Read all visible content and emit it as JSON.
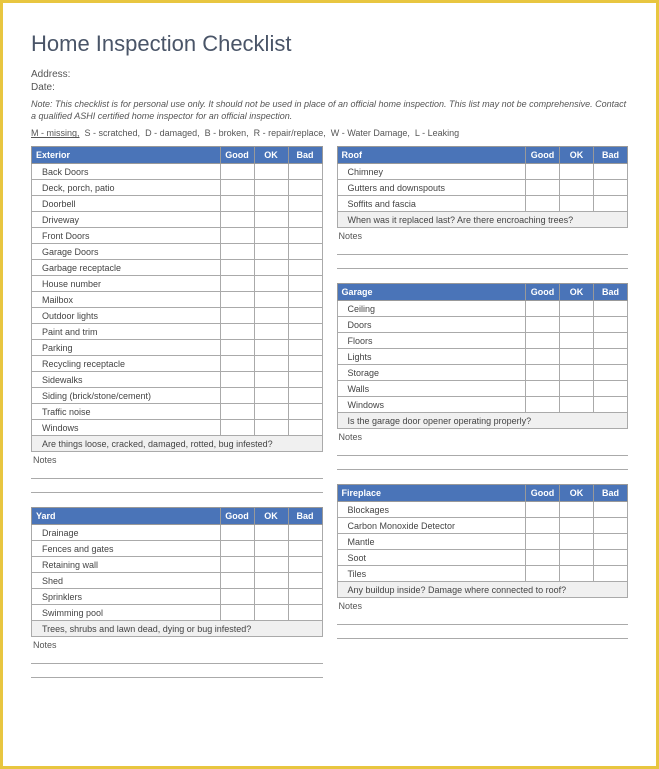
{
  "title": "Home Inspection Checklist",
  "address_label": "Address:",
  "date_label": "Date:",
  "note": "Note: This checklist is for personal use only. It should not be used in place of an official home inspection. This list may not be comprehensive. Contact a qualified ASHI certified home inspector for an official inspection.",
  "legend": {
    "m": "M - missing,",
    "s": "S - scratched,",
    "d": "D - damaged,",
    "b": "B - broken,",
    "r": "R - repair/replace,",
    "w": "W - Water Damage,",
    "l": "L - Leaking"
  },
  "cols": {
    "good": "Good",
    "ok": "OK",
    "bad": "Bad"
  },
  "notes_label": "Notes",
  "sections": {
    "exterior": {
      "title": "Exterior",
      "items": [
        "Back Doors",
        "Deck, porch, patio",
        "Doorbell",
        "Driveway",
        "Front Doors",
        "Garage Doors",
        "Garbage receptacle",
        "House number",
        "Mailbox",
        "Outdoor lights",
        "Paint and trim",
        "Parking",
        "Recycling receptacle",
        "Sidewalks",
        "Siding (brick/stone/cement)",
        "Traffic noise",
        "Windows"
      ],
      "question": "Are things loose, cracked, damaged, rotted, bug infested?",
      "note_lines": 2
    },
    "roof": {
      "title": "Roof",
      "items": [
        "Chimney",
        "Gutters and downspouts",
        "Soffits and fascia"
      ],
      "question": "When was it replaced last? Are there encroaching trees?",
      "note_lines": 2
    },
    "garage": {
      "title": "Garage",
      "items": [
        "Ceiling",
        "Doors",
        "Floors",
        "Lights",
        "Storage",
        "Walls",
        "Windows"
      ],
      "question": "Is the garage door opener operating properly?",
      "note_lines": 2
    },
    "yard": {
      "title": "Yard",
      "items": [
        "Drainage",
        "Fences and gates",
        "Retaining wall",
        "Shed",
        "Sprinklers",
        "Swimming pool"
      ],
      "question": "Trees, shrubs and lawn dead, dying or bug infested?",
      "note_lines": 2
    },
    "fireplace": {
      "title": "Fireplace",
      "items": [
        "Blockages",
        "Carbon Monoxide Detector",
        "Mantle",
        "Soot",
        "Tiles"
      ],
      "question": "Any buildup inside? Damage where connected to roof?",
      "note_lines": 2
    }
  }
}
